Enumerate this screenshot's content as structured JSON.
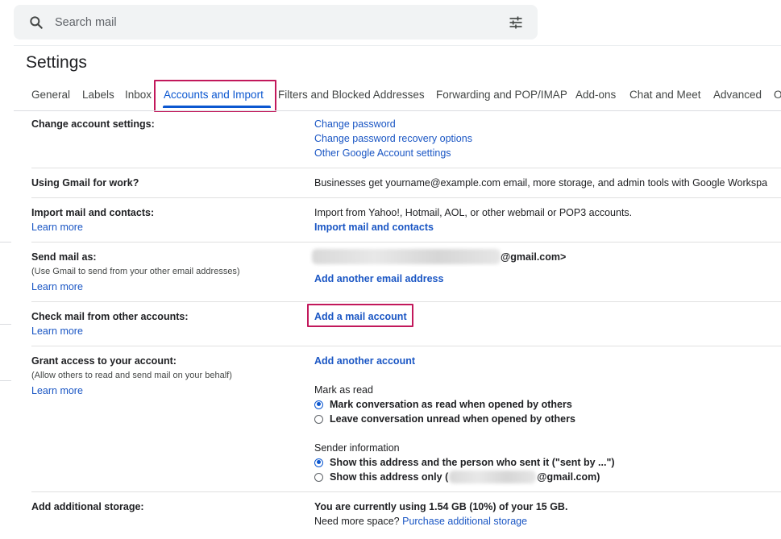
{
  "search": {
    "placeholder": "Search mail"
  },
  "page": {
    "title": "Settings"
  },
  "tabs": [
    {
      "label": "General"
    },
    {
      "label": "Labels"
    },
    {
      "label": "Inbox"
    },
    {
      "label": "Accounts and Import",
      "active": true
    },
    {
      "label": "Filters and Blocked Addresses"
    },
    {
      "label": "Forwarding and POP/IMAP"
    },
    {
      "label": "Add-ons"
    },
    {
      "label": "Chat and Meet"
    },
    {
      "label": "Advanced"
    },
    {
      "label": "O"
    }
  ],
  "sections": {
    "change_account": {
      "label": "Change account settings:",
      "links": [
        "Change password",
        "Change password recovery options",
        "Other Google Account settings"
      ]
    },
    "gmail_work": {
      "label": "Using Gmail for work?",
      "text": "Businesses get yourname@example.com email, more storage, and admin tools with Google Workspa"
    },
    "import": {
      "label": "Import mail and contacts:",
      "learn_more": "Learn more",
      "text": "Import from Yahoo!, Hotmail, AOL, or other webmail or POP3 accounts.",
      "action": "Import mail and contacts"
    },
    "send_as": {
      "label": "Send mail as:",
      "note": "(Use Gmail to send from your other email addresses)",
      "learn_more": "Learn more",
      "address_suffix": "@gmail.com>",
      "action": "Add another email address"
    },
    "check_mail": {
      "label": "Check mail from other accounts:",
      "learn_more": "Learn more",
      "action": "Add a mail account"
    },
    "grant_access": {
      "label": "Grant access to your account:",
      "note": "(Allow others to read and send mail on your behalf)",
      "learn_more": "Learn more",
      "action": "Add another account",
      "mark_as_read": {
        "title": "Mark as read",
        "options": [
          {
            "label": "Mark conversation as read when opened by others",
            "checked": true
          },
          {
            "label": "Leave conversation unread when opened by others",
            "checked": false
          }
        ]
      },
      "sender_info": {
        "title": "Sender information",
        "options": [
          {
            "label": "Show this address and the person who sent it (\"sent by ...\")",
            "checked": true
          },
          {
            "label_prefix": "Show this address only (",
            "label_suffix": "@gmail.com)",
            "checked": false
          }
        ]
      }
    },
    "storage": {
      "label": "Add additional storage:",
      "usage": "You are currently using 1.54 GB (10%) of your 15 GB.",
      "need_more": "Need more space?",
      "purchase": "Purchase additional storage"
    }
  },
  "icons": {
    "search": "search-icon",
    "filter": "tune-icon",
    "radio_checked": "radio-checked-icon",
    "radio_unchecked": "radio-unchecked-icon"
  },
  "colors": {
    "accent": "#0b57d0",
    "link": "#1a56c4",
    "highlight": "#c2185b",
    "searchbar_bg": "#f1f3f4"
  }
}
